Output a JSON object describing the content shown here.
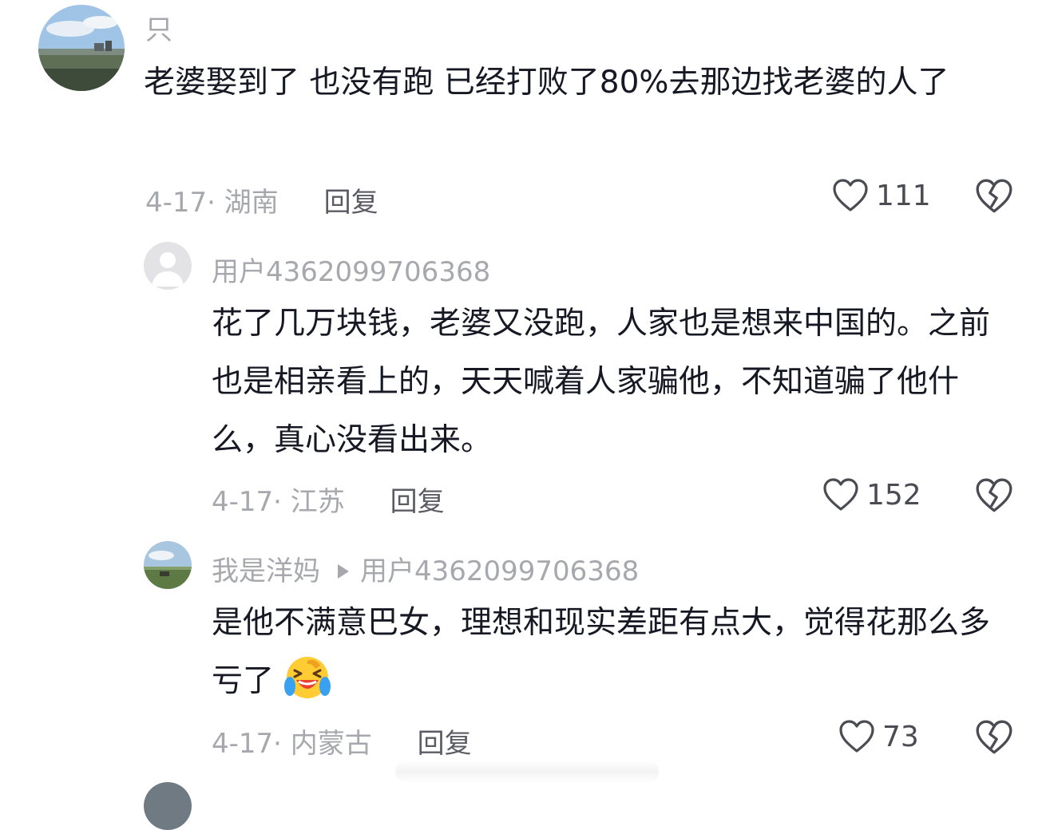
{
  "comments": [
    {
      "username": "只",
      "text": "老婆娶到了  也没有跑  已经打败了80%去那边找老婆的人了",
      "date": "4-17",
      "location": "湖南",
      "reply_label": "回复",
      "likes": "111"
    },
    {
      "username": "用户4362099706368",
      "text": "花了几万块钱，老婆又没跑，人家也是想来中国的。之前也是相亲看上的，天天喊着人家骗他，不知道骗了他什么，真心没看出来。",
      "date": "4-17",
      "location": "江苏",
      "reply_label": "回复",
      "likes": "152"
    },
    {
      "username": "我是洋妈",
      "reply_to": "用户4362099706368",
      "text": "是他不满意巴女，理想和现实差距有点大，觉得花那么多亏了",
      "emoji": "laughing-crying-emoji",
      "date": "4-17",
      "location": "内蒙古",
      "reply_label": "回复",
      "likes": "73"
    }
  ],
  "icons": {
    "like": "heart-outline-icon",
    "dislike": "broken-heart-icon"
  },
  "colors": {
    "text": "#161823",
    "muted": "#a7a8ad",
    "reply": "#5b5c63"
  }
}
